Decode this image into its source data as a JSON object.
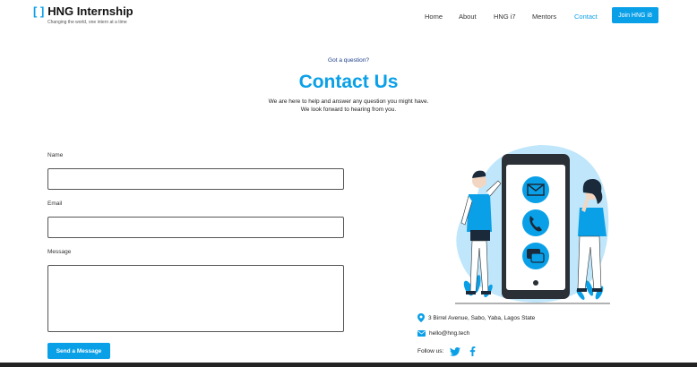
{
  "header": {
    "logo_bracket": "[ ]",
    "logo_title": "HNG Internship",
    "logo_tagline": "Changing the world, one intern at a time",
    "nav": [
      "Home",
      "About",
      "HNG i7",
      "Mentors",
      "Contact"
    ],
    "active_nav": "Contact",
    "join_label": "Join HNG i8"
  },
  "hero": {
    "kicker": "Got a question?",
    "title": "Contact Us",
    "subtitle_line1": "We are here to help and answer any question you might have.",
    "subtitle_line2": "We look forward to hearing from you."
  },
  "form": {
    "name_label": "Name",
    "name_value": "",
    "email_label": "Email",
    "email_value": "",
    "message_label": "Message",
    "message_value": "",
    "submit_label": "Send a Message"
  },
  "contact_info": {
    "address": "3 Birrel Avenue, Sabo, Yaba, Lagos State",
    "email": "hello@hng.tech",
    "follow_label": "Follow us:",
    "social_icons": [
      "twitter-icon",
      "facebook-icon"
    ]
  },
  "colors": {
    "accent": "#0aa0e8",
    "kicker": "#1c3f8a",
    "illustration_bg": "#bfe6fa"
  }
}
